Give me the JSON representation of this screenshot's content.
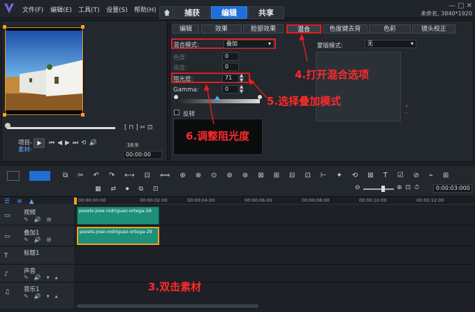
{
  "menubar": {
    "items": [
      "文件(F)",
      "编辑(E)",
      "工具(T)",
      "设置(S)",
      "帮助(H)"
    ]
  },
  "main_tabs": [
    "捕获",
    "编辑",
    "共享"
  ],
  "project": {
    "name": "未命名, 3840*1920"
  },
  "window_controls": "— □ ✕",
  "player": {
    "project_label": "项目-",
    "clip_label": "素材-",
    "timecode": "00:00:00",
    "aspect": "16:9"
  },
  "settings_tabs": [
    "编辑",
    "效果",
    "脸部效果",
    "混合",
    "色度键去背",
    "色彩",
    "镜头校正"
  ],
  "blend": {
    "mode_label": "混合模式:",
    "mode_value": "叠加",
    "hue_label": "色度:",
    "hue_value": "0",
    "brightness_label": "亮度:",
    "brightness_value": "0",
    "opacity_label": "阻光度:",
    "opacity_value": "71",
    "gamma_label": "Gamma:",
    "gamma_value": "0",
    "invert_label": "反转",
    "mask_mode_label": "蒙版模式:",
    "mask_mode_value": "无"
  },
  "annotations": {
    "step3": "3.双击素材",
    "step4": "4.打开混合选项",
    "step5": "5.选择叠加模式",
    "step6": "6.调整阻光度"
  },
  "timeline": {
    "timecode": "0:00:03:000",
    "ruler": [
      "00:00:00:00",
      "00:00:02:00",
      "00:00:04:00",
      "00:00:06:00",
      "00:00:08:00",
      "00:00:10:00",
      "00:00:12:00"
    ],
    "tracks": [
      "视频",
      "叠加1",
      "标题1",
      "声音",
      "音乐1"
    ],
    "clip_name": "pexels-jose-rodriguez-ortega-29"
  },
  "colors": {
    "accent": "#1f6fd6",
    "annotation": "#e02020",
    "clip": "#1e8f78",
    "selection": "#f0a020"
  }
}
